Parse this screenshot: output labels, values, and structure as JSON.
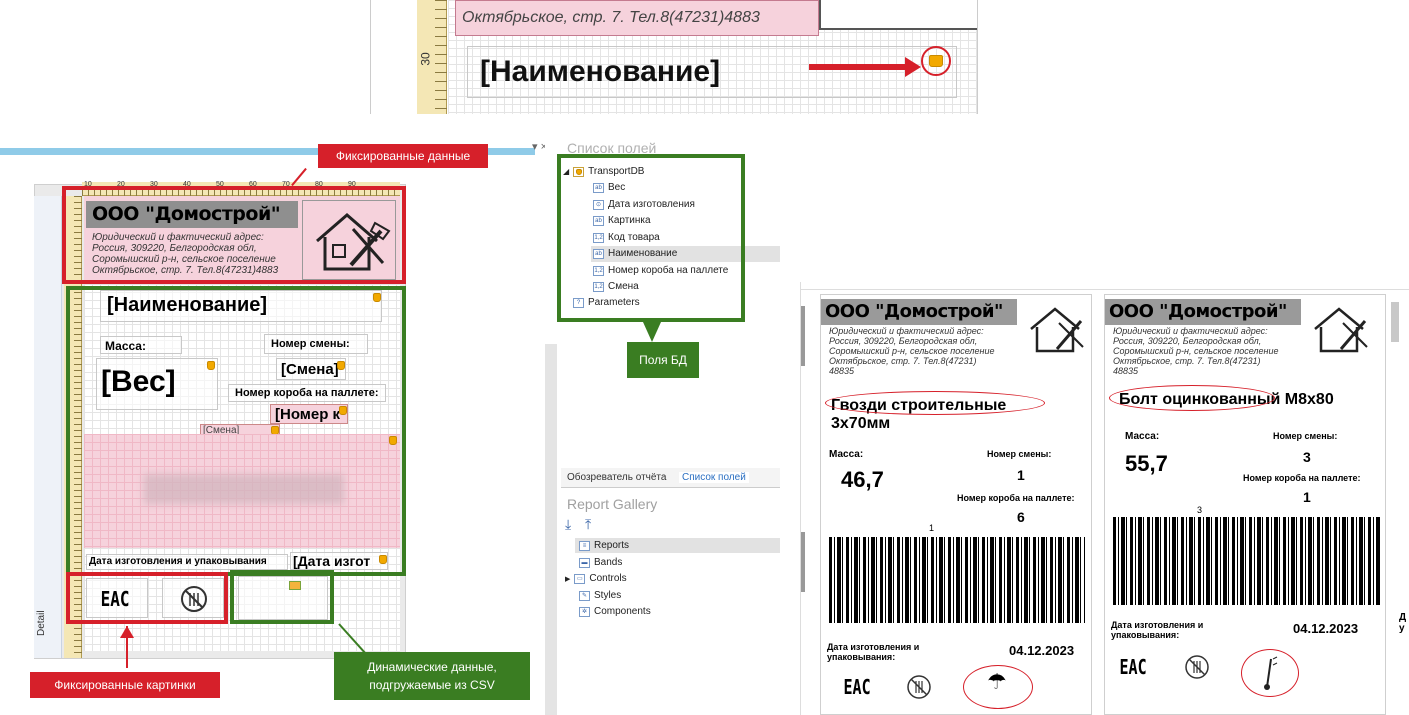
{
  "zoom_snippet": {
    "address_line": "Октябрьское, стр. 7. Тел.8(47231)4883",
    "ruler_mark": "30",
    "field_label": "[Наименование]"
  },
  "designer": {
    "close_glyph": "▾ ×",
    "company": "ООО \"Домострой\"",
    "address": [
      "Юридический и фактический адрес:",
      "Россия, 309220, Белгородская обл,",
      "Соромышский р-н, сельское поселение",
      "Октябрьское, стр. 7. Тел.8(47231)4883"
    ],
    "ruler_ticks": [
      "10",
      "20",
      "30",
      "40",
      "50",
      "60",
      "70",
      "80",
      "90"
    ],
    "name_field": "[Наименование]",
    "mass_label": "Масса:",
    "shift_label": "Номер смены:",
    "shift_field": "[Смена]",
    "weight_field": "[Вес]",
    "box_label": "Номер короба на паллете:",
    "box_field": "[Номер к",
    "shift_small": "[Смена]",
    "date_label": "Дата  изготовления  и упаковывания",
    "date_field": "[Дата изгот",
    "eac_logo": "ЕАС",
    "band_name": "Detail"
  },
  "callouts": {
    "fixed_data": "Фиксированные данные",
    "db_fields": "Поля БД",
    "fixed_images": "Фиксированные картинки",
    "dynamic_data": [
      "Динамические данные,",
      "подгружаемые из CSV"
    ]
  },
  "field_list": {
    "title": "Список полей",
    "root": "TransportDB",
    "items": [
      "Вес",
      "Дата изготовления",
      "Картинка",
      "Код товара",
      "Наименование",
      "Номер короба на паллете",
      "Смена"
    ],
    "item_types": [
      "ab",
      "⊙",
      "ab",
      "1,2",
      "ab",
      "1,2",
      "1,2"
    ],
    "parameters": "Parameters"
  },
  "explorer": {
    "tabs": [
      "Обозреватель отчёта",
      "Список полей"
    ],
    "gallery_title": "Report Gallery",
    "items": [
      "Reports",
      "Bands",
      "Controls",
      "Styles",
      "Components"
    ]
  },
  "preview": {
    "labels": [
      {
        "company": "ООО \"Домострой\"",
        "address": [
          "Юридический и фактический адрес:",
          "Россия, 309220, Белгородская обл,",
          "Соромышский р-н, сельское поселение",
          "Октябрьское, стр. 7. Тел.8(47231)",
          "48835"
        ],
        "product": [
          "Гвозди строительные",
          "3х70мм"
        ],
        "mass_label": "Масса:",
        "mass_value": "46,7",
        "shift_label": "Номер смены:",
        "shift_value": "1",
        "box_label": "Номер короба на паллете:",
        "box_value": "6",
        "barcode_top": "1",
        "date_label": [
          "Дата изготовления и",
          "упаковывания:"
        ],
        "date_value": "04.12.2023",
        "eac": "ЕАС"
      },
      {
        "company": "ООО \"Домострой\"",
        "address": [
          "Юридический и фактический адрес:",
          "Россия, 309220, Белгородская обл,",
          "Соромышский р-н, сельское поселение",
          "Октябрьское, стр. 7. Тел.8(47231)",
          "48835"
        ],
        "product": [
          "Болт оцинкованный М8х80"
        ],
        "mass_label": "Масса:",
        "mass_value": "55,7",
        "shift_label": "Номер смены:",
        "shift_value": "3",
        "box_label": "Номер короба на паллете:",
        "box_value": "1",
        "barcode_top": "3",
        "date_label": [
          "Дата изготовления и",
          "упаковывания:"
        ],
        "date_value": "04.12.2023",
        "eac": "ЕАС"
      }
    ]
  },
  "colors": {
    "red": "#d6202a",
    "green": "#3a7d22",
    "accent_blue": "#8fcbe8"
  }
}
